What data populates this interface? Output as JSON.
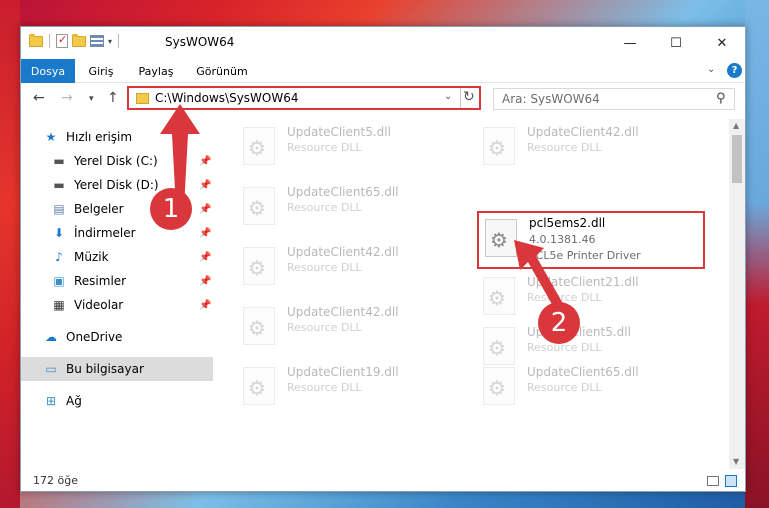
{
  "window": {
    "title": "SysWOW64"
  },
  "ribbon": {
    "tabs": [
      {
        "label": "Dosya"
      },
      {
        "label": "Giriş"
      },
      {
        "label": "Paylaş"
      },
      {
        "label": "Görünüm"
      }
    ],
    "help": "?"
  },
  "titlebar": {
    "min": "—",
    "max": "☐",
    "close": "✕"
  },
  "address": {
    "path": "C:\\Windows\\SysWOW64"
  },
  "search": {
    "placeholder": "Ara: SysWOW64"
  },
  "sidebar": {
    "items": [
      {
        "label": "Hızlı erişim",
        "icon": "star-icon",
        "pinned": false
      },
      {
        "label": "Yerel Disk (C:)",
        "icon": "drive-icon",
        "pinned": true
      },
      {
        "label": "Yerel Disk (D:)",
        "icon": "drive-icon",
        "pinned": true
      },
      {
        "label": "Belgeler",
        "icon": "documents-icon",
        "pinned": true
      },
      {
        "label": "İndirmeler",
        "icon": "download-icon",
        "pinned": true
      },
      {
        "label": "Müzik",
        "icon": "music-icon",
        "pinned": true
      },
      {
        "label": "Resimler",
        "icon": "pictures-icon",
        "pinned": true
      },
      {
        "label": "Videolar",
        "icon": "videos-icon",
        "pinned": true
      },
      {
        "label": "OneDrive",
        "icon": "cloud-icon",
        "pinned": false
      },
      {
        "label": "Bu bilgisayar",
        "icon": "computer-icon",
        "pinned": false,
        "selected": true
      },
      {
        "label": "Ağ",
        "icon": "network-icon",
        "pinned": false
      }
    ]
  },
  "files": [
    {
      "name": "UpdateClient5.dll",
      "desc": "Resource DLL"
    },
    {
      "name": "UpdateClient42.dll",
      "desc": "Resource DLL"
    },
    {
      "name": "UpdateClient65.dll",
      "desc": "Resource DLL"
    },
    {
      "name": "pcl5ems2.dll",
      "version": "4.0.1381.46",
      "desc": "PCL5e Printer Driver"
    },
    {
      "name": "UpdateClient42.dll",
      "desc": "Resource DLL"
    },
    {
      "name": "UpdateClient21.dll",
      "desc": "Resource DLL"
    },
    {
      "name": "UpdateClient42.dll",
      "desc": "Resource DLL"
    },
    {
      "name": "UpdateClient5.dll",
      "desc": "Resource DLL"
    },
    {
      "name": "UpdateClient19.dll",
      "desc": "Resource DLL"
    },
    {
      "name": "UpdateClient65.dll",
      "desc": "Resource DLL"
    }
  ],
  "status": {
    "count": "172 öğe"
  },
  "annotations": {
    "step1": "1",
    "step2": "2"
  },
  "colors": {
    "accent": "#1979ca",
    "highlight": "#d9373c"
  }
}
